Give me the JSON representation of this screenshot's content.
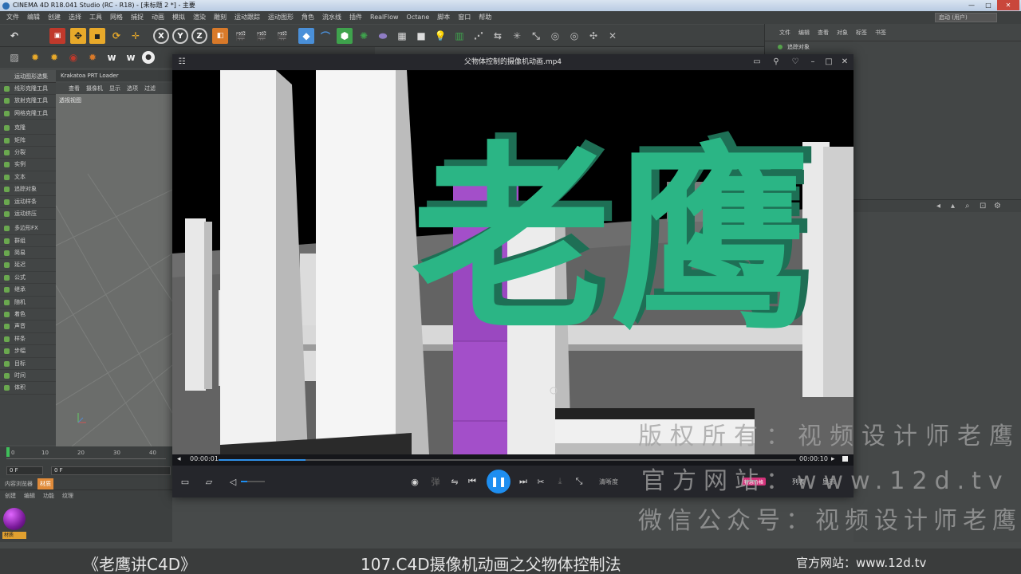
{
  "c4d": {
    "title": "CINEMA 4D R18.041 Studio (RC - R18) - [未标题 2 *] - 主要",
    "menus": [
      "文件",
      "编辑",
      "创建",
      "选择",
      "工具",
      "网格",
      "捕捉",
      "动画",
      "模拟",
      "渲染",
      "雕刻",
      "运动跟踪",
      "运动图形",
      "角色",
      "流水线",
      "插件",
      "RealFlow",
      "Octane",
      "脚本",
      "窗口",
      "帮助"
    ],
    "layout_label": "启动 (用户)",
    "left_panel_header": "运动图形选集",
    "left_panel_items": [
      "线形克隆工具",
      "放射克隆工具",
      "网格克隆工具",
      "克隆",
      "矩阵",
      "分裂",
      "实例",
      "文本",
      "追踪对象",
      "运动样条",
      "运动挤压",
      "多边形FX",
      "群组",
      "简易",
      "延迟",
      "公式",
      "继承",
      "随机",
      "着色",
      "声音",
      "样条",
      "步幅",
      "目标",
      "时间",
      "体积"
    ],
    "viewport_tabs": "Krakatoa PRT Loader",
    "viewport_menu": [
      "查看",
      "摄像机",
      "显示",
      "选项",
      "过滤"
    ],
    "viewport_label": "透视视图",
    "timeline_ticks": [
      "0",
      "10",
      "20",
      "30",
      "40"
    ],
    "frame_fields": [
      "0 F",
      "0 F"
    ],
    "mat_tabs": [
      "内容浏览器",
      "材质"
    ],
    "mat_menu": [
      "创建",
      "编辑",
      "功能",
      "纹理"
    ],
    "mat_label": "材质",
    "obj_menu": [
      "文件",
      "编辑",
      "查看",
      "对象",
      "标签",
      "书签"
    ],
    "obj_rows": [
      "追踪对象"
    ]
  },
  "player": {
    "title": "父物体控制的摄像机动画.mp4",
    "time_current": "00:00:01",
    "time_total": "00:00:10",
    "progress": 0.15,
    "quality": "清晰度",
    "badge": "特惠价格",
    "list_label": "列表",
    "fullscreen_label": "显示",
    "overlay_text": "老鹰",
    "accent_color": "#1e8ef0",
    "text_color": "#2bb585"
  },
  "watermark": {
    "line1": "版权所有：视频设计师老鹰",
    "line2": "官方网站：www.12d.tv",
    "line3": "微信公众号：视频设计师老鹰"
  },
  "caption": {
    "left": "《老鹰讲C4D》",
    "center": "107.C4D摄像机动画之父物体控制法",
    "right": "官方网站：www.12d.tv"
  }
}
